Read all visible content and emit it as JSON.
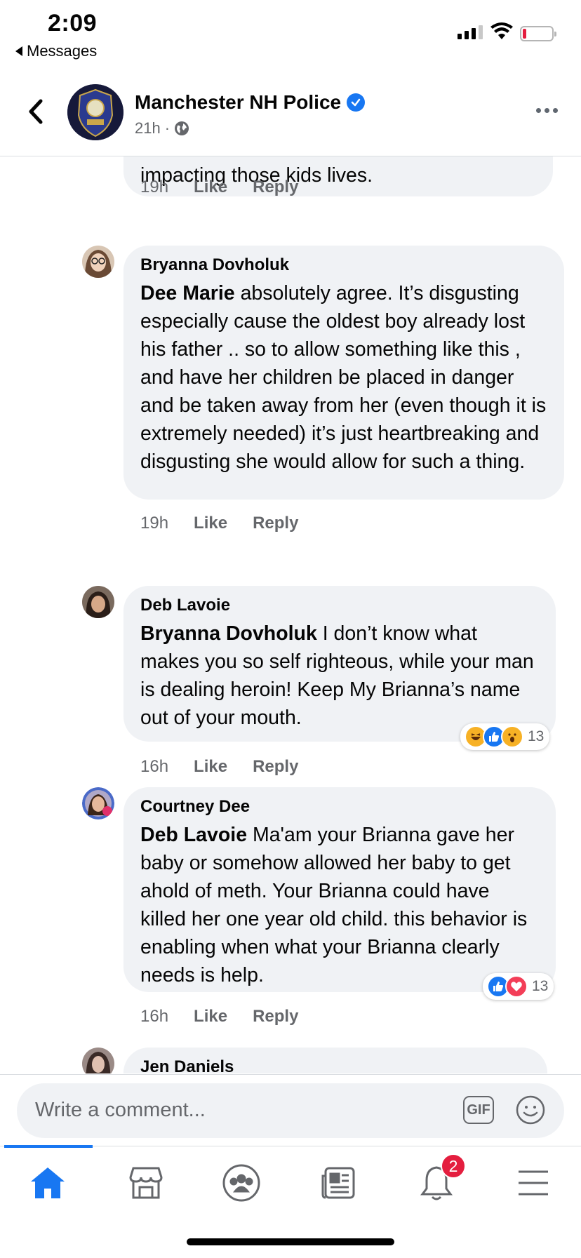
{
  "status_bar": {
    "time": "2:09",
    "back_app_label": "Messages",
    "icons": [
      "cellular-signal-icon",
      "wifi-icon",
      "battery-low-icon"
    ]
  },
  "header": {
    "page_name": "Manchester NH Police",
    "verified_icon": "verified-badge-icon",
    "post_time": "21h",
    "separator": "·",
    "privacy_icon": "globe-icon",
    "more_icon": "more-icon",
    "back_icon": "chevron-left-icon"
  },
  "comments": [
    {
      "text": "impacting those kids lives.",
      "timestamp": "19h",
      "like_label": "Like",
      "reply_label": "Reply"
    },
    {
      "author": "Bryanna Dovholuk",
      "mention": "Dee Marie",
      "text": " absolutely agree. It’s disgusting especially cause the oldest boy already lost his father .. so to allow something like this , and have her children be placed in danger and be taken away from her (even though it is extremely needed) it’s just heartbreaking and disgusting she would allow for such a thing.",
      "timestamp": "19h",
      "like_label": "Like",
      "reply_label": "Reply"
    },
    {
      "author": "Deb Lavoie",
      "mention": "Bryanna Dovholuk",
      "text": "  I don’t know what makes you so self righteous, while your man is dealing heroin! Keep My Brianna’s name out of your mouth.",
      "timestamp": "16h",
      "like_label": "Like",
      "reply_label": "Reply",
      "reactions": {
        "icons": [
          "haha-icon",
          "like-icon",
          "wow-icon"
        ],
        "count": "13"
      }
    },
    {
      "author": "Courtney Dee",
      "mention": "Deb Lavoie",
      "text": " Ma'am your Brianna gave her baby or somehow allowed her baby to get ahold of meth. Your Brianna could have killed her one year old child. this behavior is enabling when what your Brianna clearly needs is help.",
      "timestamp": "16h",
      "like_label": "Like",
      "reply_label": "Reply",
      "reactions": {
        "icons": [
          "like-icon",
          "love-icon"
        ],
        "count": "13"
      }
    },
    {
      "author": "Jen Daniels"
    }
  ],
  "composer": {
    "placeholder": "Write a comment...",
    "gif_label": "GIF",
    "emoji_icon": "smiley-icon"
  },
  "tabbar": {
    "tabs": [
      "home-icon",
      "marketplace-icon",
      "groups-icon",
      "news-icon",
      "notifications-icon",
      "menu-icon"
    ],
    "active_tab": "home-icon",
    "notifications_badge": "2"
  },
  "colors": {
    "accent": "#1877f2",
    "bubble": "#f0f2f5",
    "secondary_text": "#65676b",
    "badge": "#e41e3f"
  }
}
